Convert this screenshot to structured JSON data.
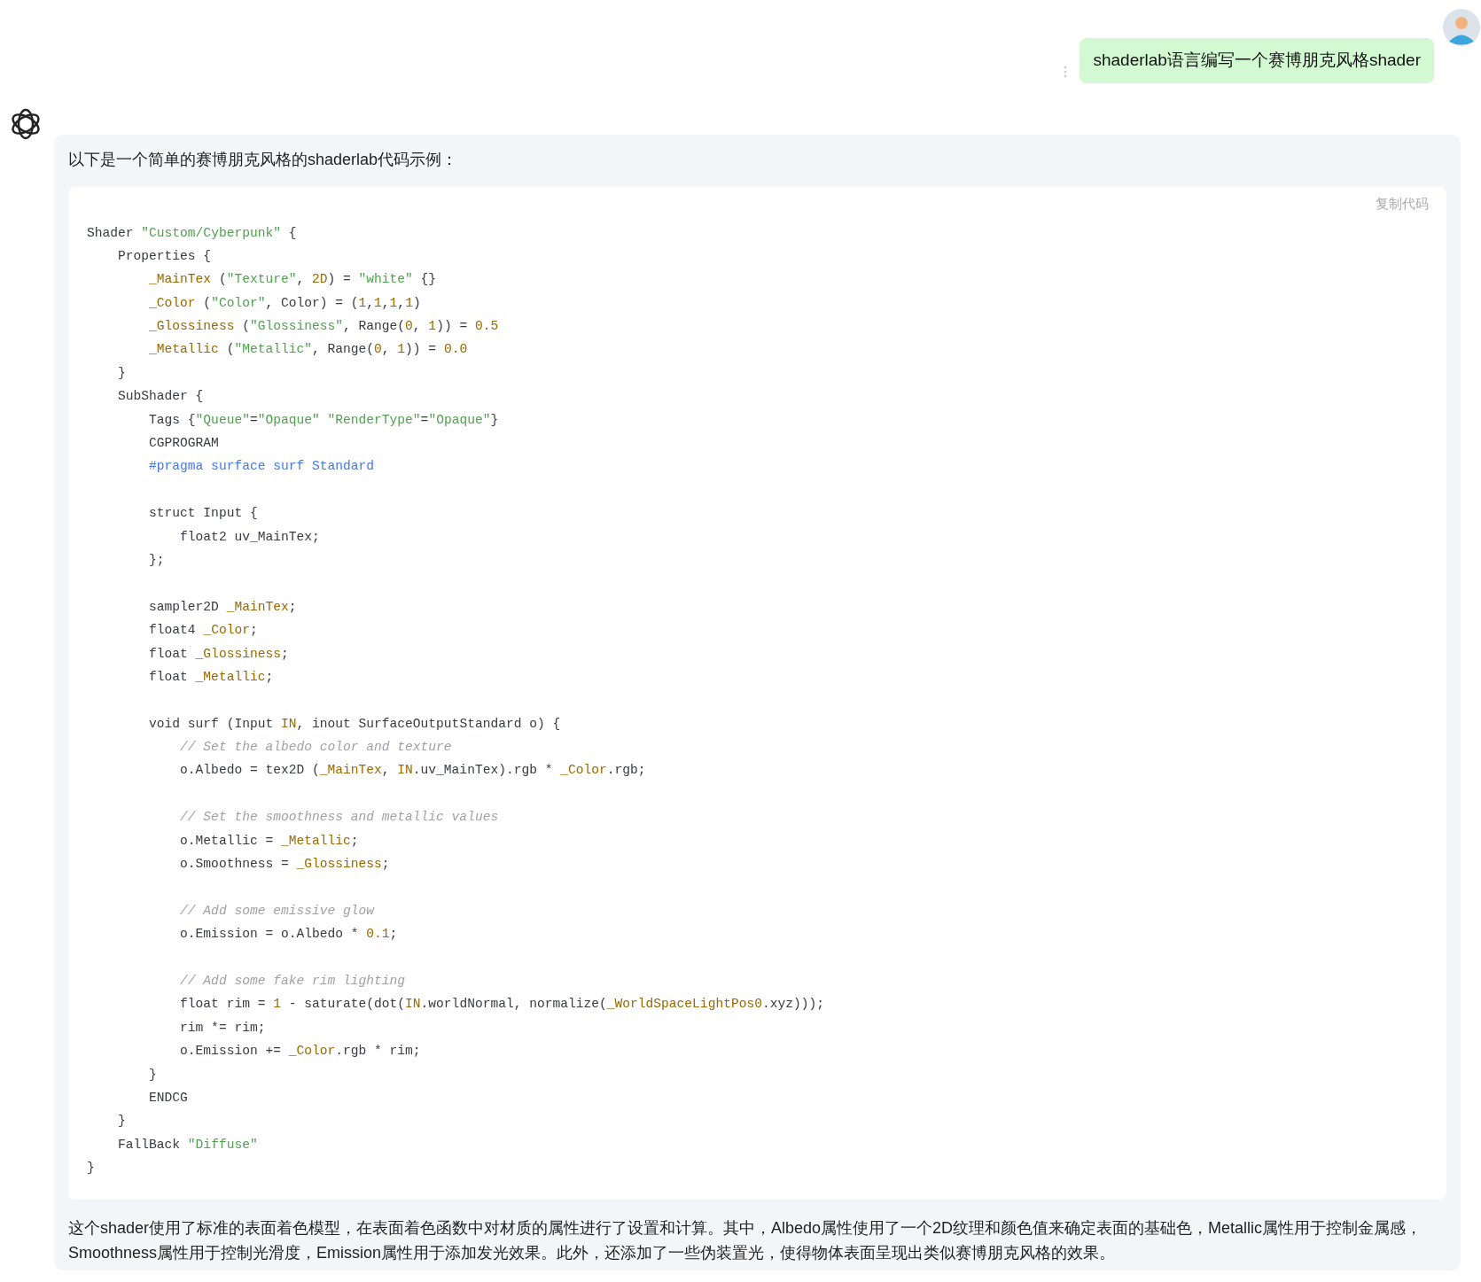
{
  "user_message": {
    "text": "shaderlab语言编写一个赛博朋克风格shader"
  },
  "reply": {
    "intro": "以下是一个简单的赛博朋克风格的shaderlab代码示例：",
    "code_block": {
      "copy_label": "复制代码",
      "lines": [
        {
          "kind": "code",
          "tokens": [
            {
              "kind": "plain",
              "text": "Shader "
            },
            {
              "kind": "string",
              "text": "\"Custom/Cyberpunk\""
            },
            {
              "kind": "plain",
              "text": " {"
            }
          ]
        },
        {
          "kind": "code",
          "tokens": [
            {
              "kind": "plain",
              "text": "    Properties {"
            }
          ]
        },
        {
          "kind": "code",
          "tokens": [
            {
              "kind": "variable",
              "text": "        _MainTex"
            },
            {
              "kind": "plain",
              "text": " ("
            },
            {
              "kind": "string",
              "text": "\"Texture\""
            },
            {
              "kind": "plain",
              "text": ", "
            },
            {
              "kind": "number",
              "text": "2D"
            },
            {
              "kind": "plain",
              "text": ") = "
            },
            {
              "kind": "string",
              "text": "\"white\""
            },
            {
              "kind": "plain",
              "text": " {}"
            }
          ]
        },
        {
          "kind": "code",
          "tokens": [
            {
              "kind": "variable",
              "text": "        _Color"
            },
            {
              "kind": "plain",
              "text": " ("
            },
            {
              "kind": "string",
              "text": "\"Color\""
            },
            {
              "kind": "plain",
              "text": ", Color) = ("
            },
            {
              "kind": "number",
              "text": "1"
            },
            {
              "kind": "plain",
              "text": ","
            },
            {
              "kind": "number",
              "text": "1"
            },
            {
              "kind": "plain",
              "text": ","
            },
            {
              "kind": "number",
              "text": "1"
            },
            {
              "kind": "plain",
              "text": ","
            },
            {
              "kind": "number",
              "text": "1"
            },
            {
              "kind": "plain",
              "text": ")"
            }
          ]
        },
        {
          "kind": "code",
          "tokens": [
            {
              "kind": "variable",
              "text": "        _Glossiness"
            },
            {
              "kind": "plain",
              "text": " ("
            },
            {
              "kind": "string",
              "text": "\"Glossiness\""
            },
            {
              "kind": "plain",
              "text": ", Range("
            },
            {
              "kind": "number",
              "text": "0"
            },
            {
              "kind": "plain",
              "text": ", "
            },
            {
              "kind": "number",
              "text": "1"
            },
            {
              "kind": "plain",
              "text": ")) = "
            },
            {
              "kind": "number",
              "text": "0.5"
            }
          ]
        },
        {
          "kind": "code",
          "tokens": [
            {
              "kind": "variable",
              "text": "        _Metallic"
            },
            {
              "kind": "plain",
              "text": " ("
            },
            {
              "kind": "string",
              "text": "\"Metallic\""
            },
            {
              "kind": "plain",
              "text": ", Range("
            },
            {
              "kind": "number",
              "text": "0"
            },
            {
              "kind": "plain",
              "text": ", "
            },
            {
              "kind": "number",
              "text": "1"
            },
            {
              "kind": "plain",
              "text": ")) = "
            },
            {
              "kind": "number",
              "text": "0.0"
            }
          ]
        },
        {
          "kind": "code",
          "tokens": [
            {
              "kind": "plain",
              "text": "    }"
            }
          ]
        },
        {
          "kind": "code",
          "tokens": [
            {
              "kind": "plain",
              "text": "    SubShader {"
            }
          ]
        },
        {
          "kind": "code",
          "tokens": [
            {
              "kind": "plain",
              "text": "        Tags {"
            },
            {
              "kind": "string",
              "text": "\"Queue\""
            },
            {
              "kind": "plain",
              "text": "="
            },
            {
              "kind": "string",
              "text": "\"Opaque\" "
            },
            {
              "kind": "string",
              "text": "\"RenderType\""
            },
            {
              "kind": "plain",
              "text": "="
            },
            {
              "kind": "string",
              "text": "\"Opaque\""
            },
            {
              "kind": "plain",
              "text": "}"
            }
          ]
        },
        {
          "kind": "code",
          "tokens": [
            {
              "kind": "plain",
              "text": "        CGPROGRAM"
            }
          ]
        },
        {
          "kind": "code",
          "tokens": [
            {
              "kind": "directive",
              "text": "        #pragma surface surf Standard"
            }
          ]
        },
        {
          "kind": "blank"
        },
        {
          "kind": "code",
          "tokens": [
            {
              "kind": "plain",
              "text": "        struct Input {"
            }
          ]
        },
        {
          "kind": "code",
          "tokens": [
            {
              "kind": "plain",
              "text": "            float2 uv_MainTex;"
            }
          ]
        },
        {
          "kind": "code",
          "tokens": [
            {
              "kind": "plain",
              "text": "        };"
            }
          ]
        },
        {
          "kind": "blank"
        },
        {
          "kind": "code",
          "tokens": [
            {
              "kind": "plain",
              "text": "        sampler2D "
            },
            {
              "kind": "variable",
              "text": "_MainTex"
            },
            {
              "kind": "plain",
              "text": ";"
            }
          ]
        },
        {
          "kind": "code",
          "tokens": [
            {
              "kind": "plain",
              "text": "        float4 "
            },
            {
              "kind": "variable",
              "text": "_Color"
            },
            {
              "kind": "plain",
              "text": ";"
            }
          ]
        },
        {
          "kind": "code",
          "tokens": [
            {
              "kind": "plain",
              "text": "        float "
            },
            {
              "kind": "variable",
              "text": "_Glossiness"
            },
            {
              "kind": "plain",
              "text": ";"
            }
          ]
        },
        {
          "kind": "code",
          "tokens": [
            {
              "kind": "plain",
              "text": "        float "
            },
            {
              "kind": "variable",
              "text": "_Metallic"
            },
            {
              "kind": "plain",
              "text": ";"
            }
          ]
        },
        {
          "kind": "blank"
        },
        {
          "kind": "code",
          "tokens": [
            {
              "kind": "plain",
              "text": "        void surf (Input "
            },
            {
              "kind": "variable",
              "text": "IN"
            },
            {
              "kind": "plain",
              "text": ", inout SurfaceOutputStandard o) {"
            }
          ]
        },
        {
          "kind": "code",
          "tokens": [
            {
              "kind": "comment",
              "text": "            // Set the albedo color and texture"
            }
          ]
        },
        {
          "kind": "code",
          "tokens": [
            {
              "kind": "plain",
              "text": "            o.Albedo = tex2D ("
            },
            {
              "kind": "variable",
              "text": "_MainTex"
            },
            {
              "kind": "plain",
              "text": ", "
            },
            {
              "kind": "variable",
              "text": "IN"
            },
            {
              "kind": "plain",
              "text": ".uv_MainTex).rgb * "
            },
            {
              "kind": "variable",
              "text": "_Color"
            },
            {
              "kind": "plain",
              "text": ".rgb;"
            }
          ]
        },
        {
          "kind": "blank"
        },
        {
          "kind": "code",
          "tokens": [
            {
              "kind": "comment",
              "text": "            // Set the smoothness and metallic values"
            }
          ]
        },
        {
          "kind": "code",
          "tokens": [
            {
              "kind": "plain",
              "text": "            o.Metallic = "
            },
            {
              "kind": "variable",
              "text": "_Metallic"
            },
            {
              "kind": "plain",
              "text": ";"
            }
          ]
        },
        {
          "kind": "code",
          "tokens": [
            {
              "kind": "plain",
              "text": "            o.Smoothness = "
            },
            {
              "kind": "variable",
              "text": "_Glossiness"
            },
            {
              "kind": "plain",
              "text": ";"
            }
          ]
        },
        {
          "kind": "blank"
        },
        {
          "kind": "code",
          "tokens": [
            {
              "kind": "comment",
              "text": "            // Add some emissive glow"
            }
          ]
        },
        {
          "kind": "code",
          "tokens": [
            {
              "kind": "plain",
              "text": "            o.Emission = o.Albedo * "
            },
            {
              "kind": "number",
              "text": "0.1"
            },
            {
              "kind": "plain",
              "text": ";"
            }
          ]
        },
        {
          "kind": "blank"
        },
        {
          "kind": "code",
          "tokens": [
            {
              "kind": "comment",
              "text": "            // Add some fake rim lighting"
            }
          ]
        },
        {
          "kind": "code",
          "tokens": [
            {
              "kind": "plain",
              "text": "            float rim = "
            },
            {
              "kind": "number",
              "text": "1"
            },
            {
              "kind": "plain",
              "text": " - saturate(dot("
            },
            {
              "kind": "variable",
              "text": "IN"
            },
            {
              "kind": "plain",
              "text": ".worldNormal, normalize("
            },
            {
              "kind": "variable",
              "text": "_WorldSpaceLightPos0"
            },
            {
              "kind": "plain",
              "text": ".xyz)));"
            }
          ]
        },
        {
          "kind": "code",
          "tokens": [
            {
              "kind": "plain",
              "text": "            rim *= rim;"
            }
          ]
        },
        {
          "kind": "code",
          "tokens": [
            {
              "kind": "plain",
              "text": "            o.Emission += "
            },
            {
              "kind": "variable",
              "text": "_Color"
            },
            {
              "kind": "plain",
              "text": ".rgb * rim;"
            }
          ]
        },
        {
          "kind": "code",
          "tokens": [
            {
              "kind": "plain",
              "text": "        }"
            }
          ]
        },
        {
          "kind": "code",
          "tokens": [
            {
              "kind": "plain",
              "text": "        ENDCG"
            }
          ]
        },
        {
          "kind": "code",
          "tokens": [
            {
              "kind": "plain",
              "text": "    }"
            }
          ]
        },
        {
          "kind": "code",
          "tokens": [
            {
              "kind": "plain",
              "text": "    FallBack "
            },
            {
              "kind": "string",
              "text": "\"Diffuse\""
            }
          ]
        },
        {
          "kind": "code",
          "tokens": [
            {
              "kind": "plain",
              "text": "}"
            }
          ]
        }
      ]
    },
    "summary": "这个shader使用了标准的表面着色模型，在表面着色函数中对材质的属性进行了设置和计算。其中，Albedo属性使用了一个2D纹理和颜色值来确定表面的基础色，Metallic属性用于控制金属感，Smoothness属性用于控制光滑度，Emission属性用于添加发光效果。此外，还添加了一些伪装置光，使得物体表面呈现出类似赛博朋克风格的效果。"
  }
}
